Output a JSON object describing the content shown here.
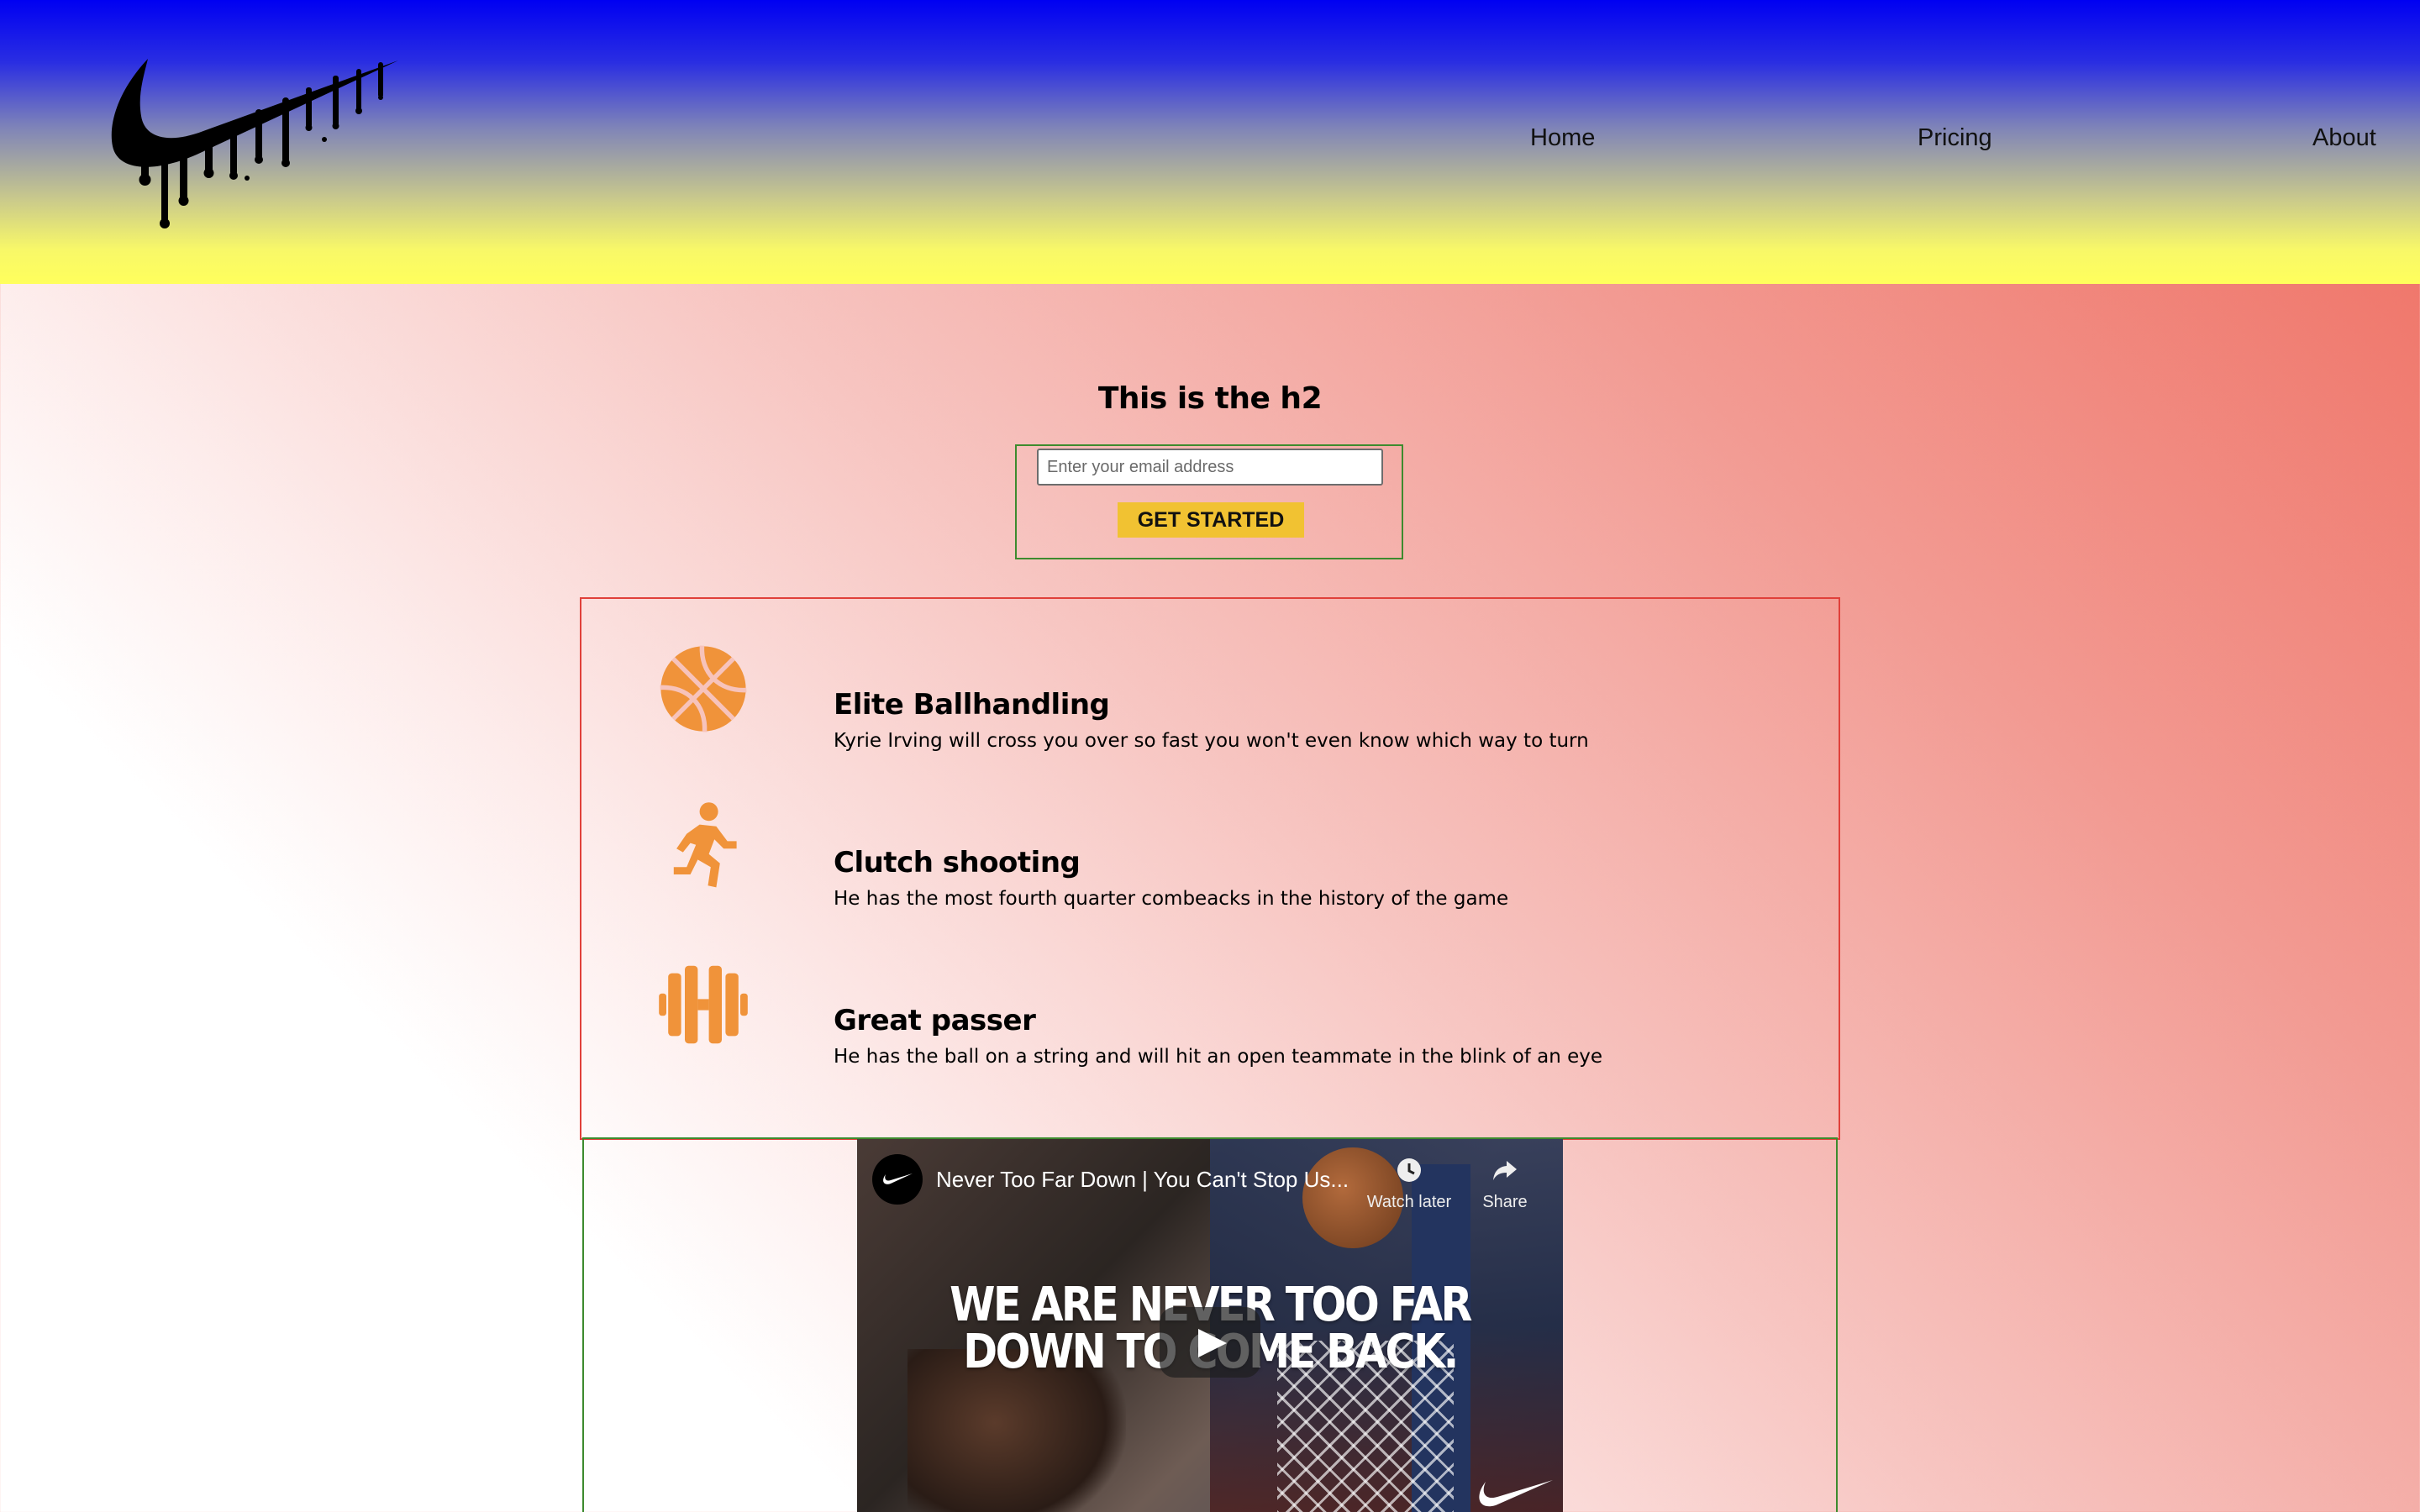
{
  "header": {
    "nav": [
      {
        "label": "Home"
      },
      {
        "label": "Pricing"
      },
      {
        "label": "About"
      }
    ]
  },
  "hero": {
    "title": "This is the h2",
    "email_placeholder": "Enter your email address",
    "cta_label": "GET STARTED"
  },
  "features": [
    {
      "icon": "basketball-icon",
      "title": "Elite Ballhandling",
      "description": "Kyrie Irving will cross you over so fast you won't even know which way to turn"
    },
    {
      "icon": "running-person-icon",
      "title": "Clutch shooting",
      "description": "He has the most fourth quarter combeacks in the history of the game"
    },
    {
      "icon": "dumbbell-icon",
      "title": "Great passer",
      "description": "He has the ball on a string and will hit an open teammate in the blink of an eye"
    }
  ],
  "video": {
    "title": "Never Too Far Down | You Can't Stop Us...",
    "watch_later_label": "Watch later",
    "share_label": "Share",
    "overlay_line1": "WE ARE NEVER TOO FAR",
    "overlay_line2": "DOWN TO COME BACK."
  },
  "colors": {
    "header_gradient_top": "#0000f2",
    "header_gradient_bottom": "#ffff5c",
    "cta_bg": "#f1c232",
    "icon_orange": "#f0933a",
    "features_border": "#e0403a",
    "signup_border": "#3d8b2e"
  }
}
